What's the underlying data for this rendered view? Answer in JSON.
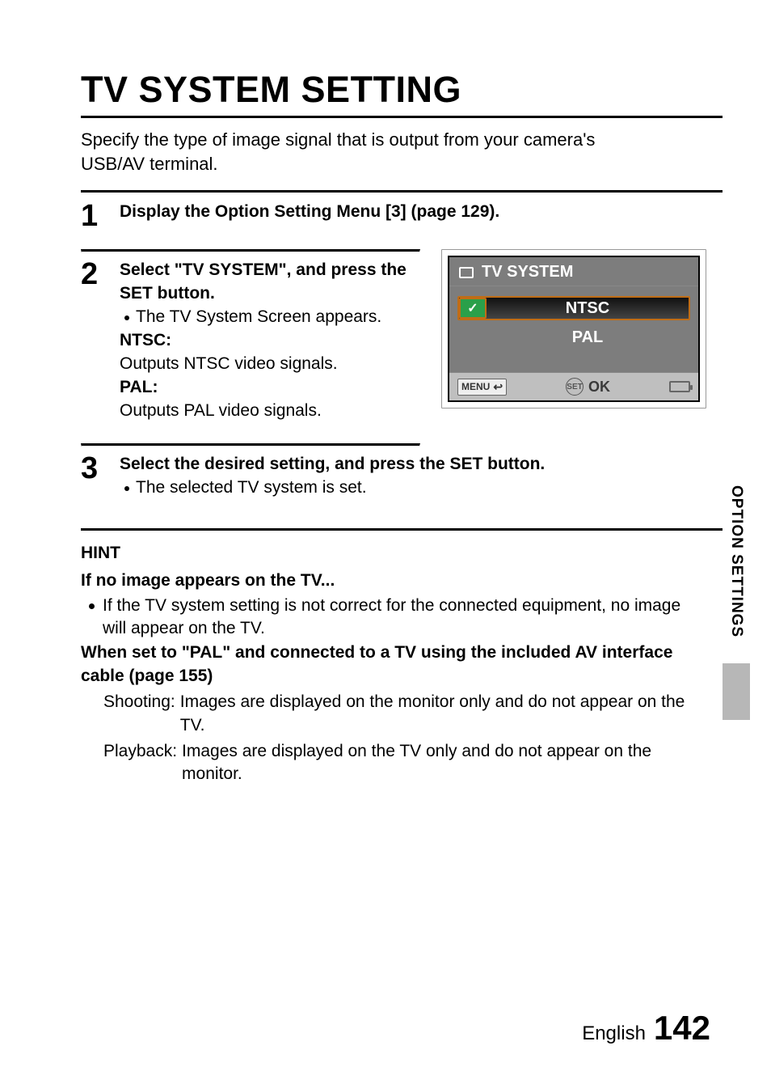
{
  "title": "TV SYSTEM SETTING",
  "intro": "Specify the type of image signal that is output from your camera's USB/AV terminal.",
  "steps": {
    "s1": {
      "num": "1",
      "text": "Display the Option Setting Menu [3] (page 129)."
    },
    "s2": {
      "num": "2",
      "head": "Select \"TV SYSTEM\", and press the SET button.",
      "bullet": "The TV System Screen appears.",
      "ntsc_label": "NTSC:",
      "ntsc_text": "Outputs NTSC video signals.",
      "pal_label": "PAL:",
      "pal_text": "Outputs PAL video signals."
    },
    "s3": {
      "num": "3",
      "head": "Select the desired setting, and press the SET button.",
      "bullet": "The selected TV system is set."
    }
  },
  "camera": {
    "title": "TV SYSTEM",
    "opt1": "NTSC",
    "opt2": "PAL",
    "menu": "MENU",
    "set": "SET",
    "ok": "OK"
  },
  "hint": {
    "title": "HINT",
    "sub1": "If no image appears on the TV...",
    "b1": "If the TV system setting is not correct for the connected equipment, no image will appear on the TV.",
    "sub2": "When set to \"PAL\" and connected to a TV using the included AV interface cable (page 155)",
    "shoot_k": "Shooting:",
    "shoot_v": "Images are displayed on the monitor only and do not appear on the TV.",
    "play_k": "Playback:",
    "play_v": "Images are displayed on the TV only and do not appear on the monitor."
  },
  "side_tab": "OPTION SETTINGS",
  "footer_lang": "English",
  "footer_page": "142"
}
